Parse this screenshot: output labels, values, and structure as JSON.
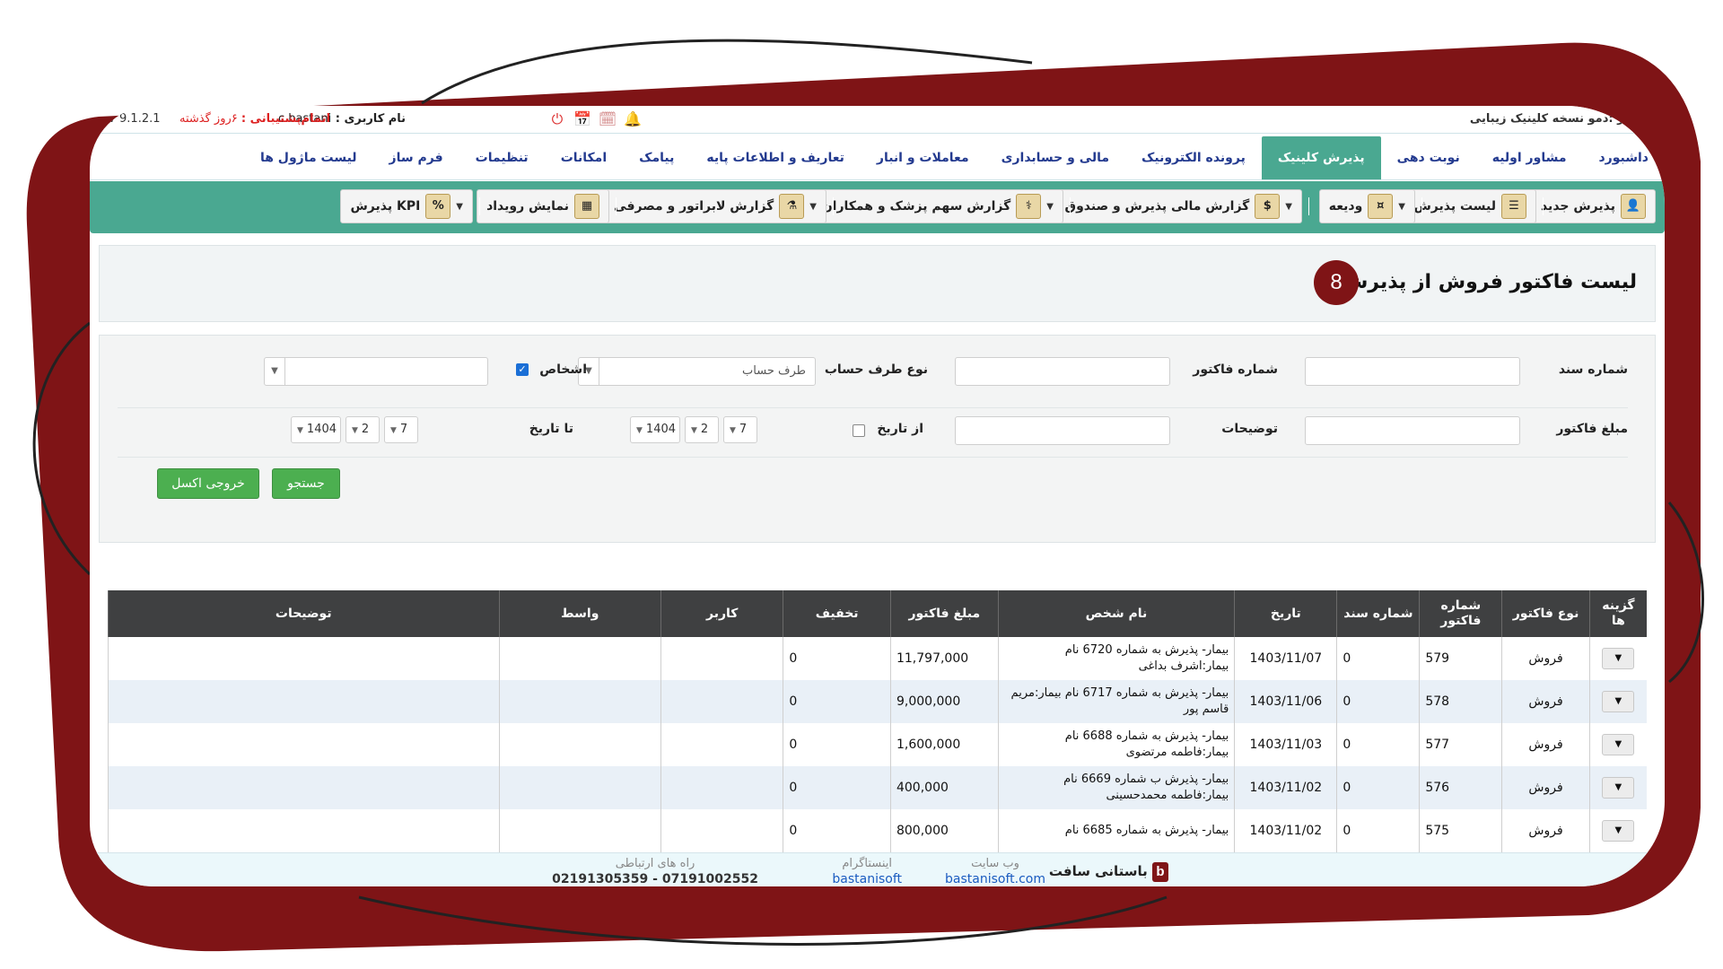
{
  "colors": {
    "accent": "#4aa891",
    "frame": "#7f1416",
    "header_dark": "#3f4041",
    "green_button": "#4caf50"
  },
  "topbar": {
    "left_text": "کاربر :دمو نسخه کلینیک زیبایی",
    "user_label": "نام کاربری :",
    "user_value": "c.bastani",
    "support_label": "اتمام‌پشتیبانی :",
    "support_value": "۶روز گذشته",
    "version": "V 9.1.2.1",
    "icons": [
      "bell-icon",
      "calendar-icon",
      "calendar-check-icon",
      "power-icon"
    ]
  },
  "tabs": [
    {
      "label": "داشبورد",
      "active": false
    },
    {
      "label": "مشاور اولیه",
      "active": false
    },
    {
      "label": "نوبت دهی",
      "active": false
    },
    {
      "label": "پذیرش کلینیک",
      "active": true
    },
    {
      "label": "پرونده الکترونیک",
      "active": false
    },
    {
      "label": "مالی و حسابداری",
      "active": false
    },
    {
      "label": "معاملات و انبار",
      "active": false
    },
    {
      "label": "تعاریف و اطلاعات پایه",
      "active": false
    },
    {
      "label": "پیامک",
      "active": false
    },
    {
      "label": "امکانات",
      "active": false
    },
    {
      "label": "تنظیمات",
      "active": false
    },
    {
      "label": "فرم ساز",
      "active": false
    },
    {
      "label": "لیست ماژول ها",
      "active": false
    }
  ],
  "toolbar": {
    "new_reception": "پذیرش جدید",
    "reception_list": "لیست پذیرش",
    "deposit": "ودیعه",
    "financial_report": "گزارش مالی پذیرش و صندوق",
    "doctor_share_report": "گزارش سهم پزشک و همکاران",
    "lab_report": "گزارش لابراتور و مصرفی ها",
    "show_event": "نمایش رویداد",
    "kpi": "KPI پذیرش"
  },
  "page": {
    "title": "لیست فاکتور فروش از پذیرش",
    "badge": "8"
  },
  "filters": {
    "doc_number_label": "شماره سند",
    "invoice_number_label": "شماره فاکتور",
    "account_side_label": "نوع طرف حساب",
    "account_side_value": "طرف حساب",
    "persons_label": "اشخاص",
    "invoice_amount_label": "مبلغ فاکتور",
    "description_label": "توضیحات",
    "from_date_label": "از تاریخ",
    "to_date_label": "تا تاریخ",
    "from_date": {
      "day": "7",
      "month": "2",
      "year": "1404"
    },
    "to_date": {
      "day": "7",
      "month": "2",
      "year": "1404"
    },
    "search_button": "جستجو",
    "excel_button": "خروجی اکسل"
  },
  "table": {
    "headers": [
      "گزینه ها",
      "نوع فاکتور",
      "شماره فاکتور",
      "شماره سند",
      "تاریخ",
      "نام شخص",
      "مبلغ فاکتور",
      "تخفیف",
      "کاربر",
      "واسط",
      "توضیحات"
    ],
    "rows": [
      {
        "type": "فروش",
        "invoice": "579",
        "doc": "0",
        "date": "1403/11/07",
        "name": "بیمار- پذیرش به شماره 6720 نام بیمار:اشرف بداغی",
        "amount": "11,797,000",
        "discount": "0",
        "user": "",
        "broker": "",
        "desc": ""
      },
      {
        "type": "فروش",
        "invoice": "578",
        "doc": "0",
        "date": "1403/11/06",
        "name": "بیمار- پذیرش به شماره 6717 نام بیمار:مریم قاسم پور",
        "amount": "9,000,000",
        "discount": "0",
        "user": "",
        "broker": "",
        "desc": ""
      },
      {
        "type": "فروش",
        "invoice": "577",
        "doc": "0",
        "date": "1403/11/03",
        "name": "بیمار- پذیرش به شماره 6688 نام بیمار:فاطمه مرتضوی",
        "amount": "1,600,000",
        "discount": "0",
        "user": "",
        "broker": "",
        "desc": ""
      },
      {
        "type": "فروش",
        "invoice": "576",
        "doc": "0",
        "date": "1403/11/02",
        "name": "بیمار- پذیرش ب شماره 6669 نام بیمار:فاطمه محمدحسینی",
        "amount": "400,000",
        "discount": "0",
        "user": "",
        "broker": "",
        "desc": ""
      },
      {
        "type": "فروش",
        "invoice": "575",
        "doc": "0",
        "date": "1403/11/02",
        "name": "بیمار- پذیرش به شماره 6685 نام",
        "amount": "800,000",
        "discount": "0",
        "user": "",
        "broker": "",
        "desc": ""
      }
    ]
  },
  "footer": {
    "brand": "باستانی سافت",
    "website_label": "وب سایت",
    "website_value": "bastanisoft.com",
    "instagram_label": "اینستاگرام",
    "instagram_value": "bastanisoft",
    "contact_label": "راه های ارتباطی",
    "contact_value": "07191002552 - 02191305359"
  }
}
